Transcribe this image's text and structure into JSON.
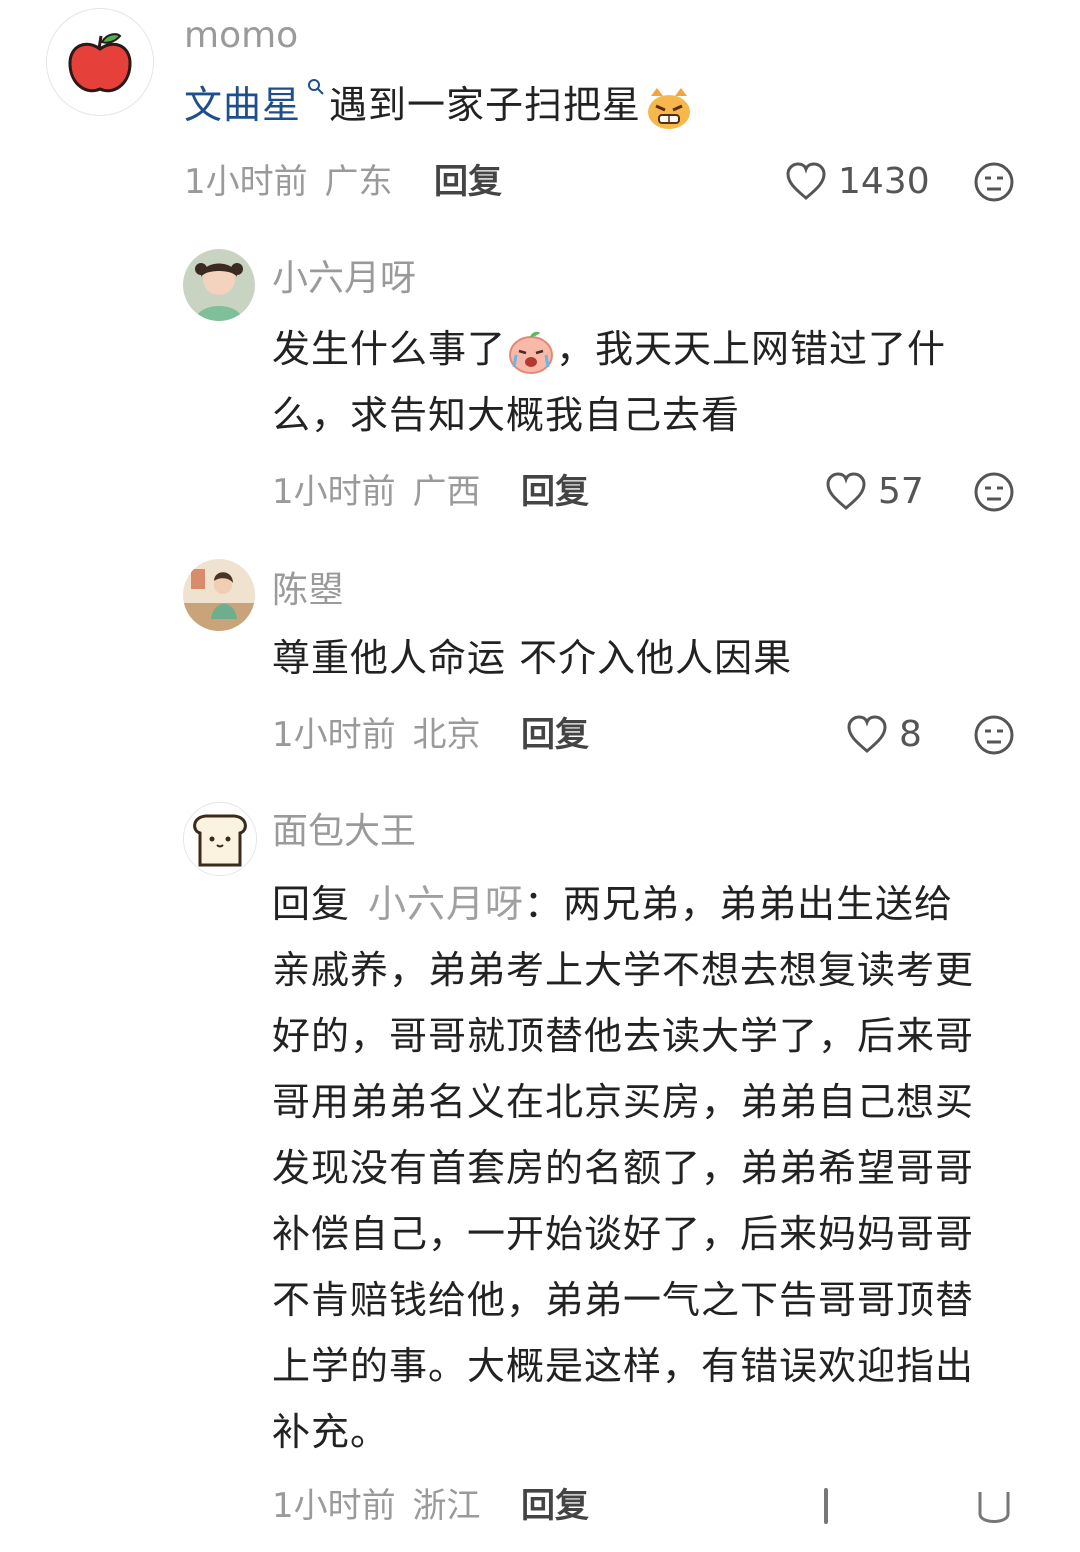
{
  "comments": [
    {
      "username": "momo",
      "link_text": "文曲星",
      "text": "遇到一家子扫把星",
      "time": "1小时前",
      "location": "广东",
      "reply_label": "回复",
      "likes": "1430"
    },
    {
      "username": "小六月呀",
      "text_line1": "发生什么事了",
      "text_line1b": "，我天天上网错过了什",
      "text_line2": "么，求告知大概我自己去看",
      "time": "1小时前",
      "location": "广西",
      "reply_label": "回复",
      "likes": "57"
    },
    {
      "username": "陈曌",
      "text": "尊重他人命运 不介入他人因果",
      "time": "1小时前",
      "location": "北京",
      "reply_label": "回复",
      "likes": "8"
    },
    {
      "username": "面包大王",
      "reply_prefix": "回复",
      "reply_to": "小六月呀",
      "lines": [
        "：两兄弟，弟弟出生送给",
        "亲戚养，弟弟考上大学不想去想复读考更",
        "好的，哥哥就顶替他去读大学了，后来哥",
        "哥用弟弟名义在北京买房，弟弟自己想买",
        "发现没有首套房的名额了，弟弟希望哥哥",
        "补偿自己，一开始谈好了，后来妈妈哥哥",
        "不肯赔钱给他，弟弟一气之下告哥哥顶替",
        "上学的事。大概是这样，有错误欢迎指出",
        "补充。"
      ],
      "time": "1小时前",
      "location": "浙江",
      "reply_label": "回复"
    }
  ]
}
